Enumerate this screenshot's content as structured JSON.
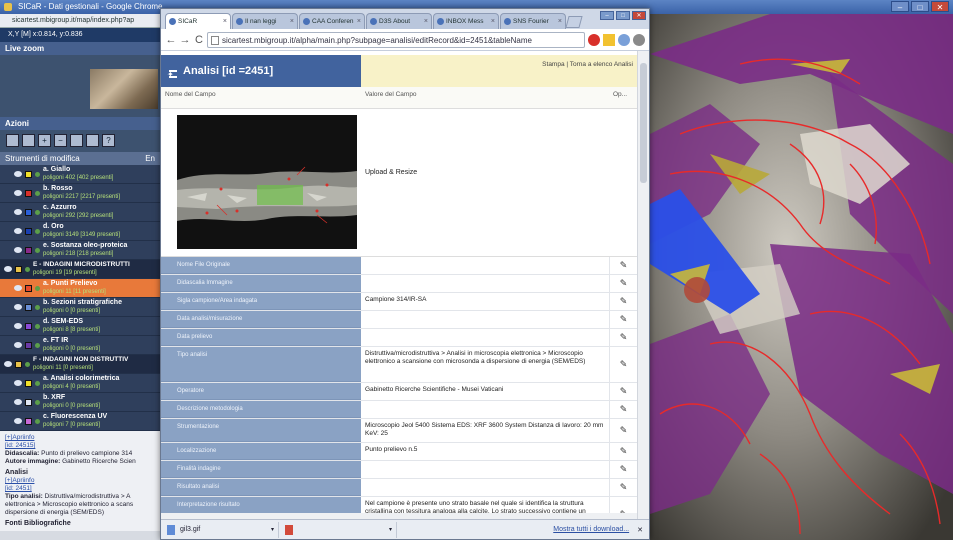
{
  "bg_window": {
    "title": "SICaR - Dati gestionali - Google Chrome",
    "address": "sicartest.mbigroup.it/map/index.php?ap",
    "coord_readout": "X,Y     [M] x:0.814, y:0.836"
  },
  "left_panel": {
    "live_zoom_title": "Live zoom",
    "actions_title": "Azioni",
    "tools_title": "Strumenti di modifica",
    "tools_right": "En",
    "layers": [
      {
        "name": "a. Giallo",
        "sub": "poligoni 402 [402 presenti]",
        "color": "#f0e02a",
        "type": "sub"
      },
      {
        "name": "b. Rosso",
        "sub": "poligoni 2217 [2217 presenti]",
        "color": "#d8302a",
        "type": "sub"
      },
      {
        "name": "c. Azzurro",
        "sub": "poligoni 292 [292 presenti]",
        "color": "#2a5fd8",
        "type": "sub"
      },
      {
        "name": "d. Oro",
        "sub": "poligoni 3149 [3149 presenti]",
        "color": "#1a3fb0",
        "type": "sub"
      },
      {
        "name": "e. Sostanza oleo-proteica",
        "sub": "poligoni 218 [218 presenti]",
        "color": "#8a2a8a",
        "type": "sub"
      },
      {
        "name": "E - INDAGINI MICRODISTRUTTI",
        "sub": "poligoni 19 [19 presenti]",
        "color": "#e8c24a",
        "type": "group"
      },
      {
        "name": "a. Punti Prelievo",
        "sub": "poligoni 11 [11 presenti]",
        "color": "#e84a2a",
        "type": "selected"
      },
      {
        "name": "b. Sezioni stratigrafiche",
        "sub": "poligoni 0 [0 presenti]",
        "color": "#6a8fd6",
        "type": "sub"
      },
      {
        "name": "d. SEM-EDS",
        "sub": "poligoni 8 [8 presenti]",
        "color": "#8a4ad6",
        "type": "sub"
      },
      {
        "name": "e. FT IR",
        "sub": "poligoni 0 [0 presenti]",
        "color": "#6a3aa6",
        "type": "sub"
      },
      {
        "name": "F - INDAGINI NON DISTRUTTIV",
        "sub": "poligoni 11 [0 presenti]",
        "color": "#e8c24a",
        "type": "group"
      },
      {
        "name": "a. Analisi colorimetrica",
        "sub": "poligoni 4 [0 presenti]",
        "color": "#f0e02a",
        "type": "sub"
      },
      {
        "name": "b. XRF",
        "sub": "poligoni 0 [0 presenti]",
        "color": "#dfe6f3",
        "type": "sub"
      },
      {
        "name": "c. Fluorescenza UV",
        "sub": "poligoni 7 [0 presenti]",
        "color": "#c86ad6",
        "type": "sub"
      }
    ],
    "info": {
      "link1": "[+]Apriinfo",
      "id1": "[id: 24515]",
      "den_label": "Didascalia:",
      "den_value": "Punto di prelievo campione 314",
      "autore_label": "Autore immagine:",
      "autore_value": "Gabinetto Ricerche Scien",
      "analisi_title": "Analisi",
      "link2": "[+]Apriinfo",
      "id2": "[id: 2451]",
      "tipo_label": "Tipo analisi:",
      "tipo_value": "Distruttiva/microdistruttiva > A elettronica > Microscopio elettronico a scans dispersione di energia (SEM/EDS)",
      "fonti_title": "Fonti Bibliografiche"
    }
  },
  "browser": {
    "tabs": [
      {
        "label": "SICaR",
        "active": true
      },
      {
        "label": "Il nan leggi",
        "active": false
      },
      {
        "label": "CAA Conferen",
        "active": false
      },
      {
        "label": "D3S About",
        "active": false
      },
      {
        "label": "INBOX Mess",
        "active": false
      },
      {
        "label": "SNS Fourier",
        "active": false
      }
    ],
    "url": "sicartest.mbigroup.it/alpha/main.php?subpage=analisi/editRecord&id=2451&tableName",
    "page": {
      "title": "Analisi [id =2451]",
      "top_links": "Stampa | Torna a elenco Analisi",
      "col_name": "Nome del Campo",
      "col_value": "Valore del Campo",
      "col_ops": "Op...",
      "upload_label": "Upload & Resize",
      "rows": [
        {
          "key": "Nome File Originale",
          "value": ""
        },
        {
          "key": "Didascalia Immagine",
          "value": ""
        },
        {
          "key": "Sigla campione/Area indagata",
          "value": "Campione 314/IR-SA"
        },
        {
          "key": "Data analisi/misurazione",
          "value": ""
        },
        {
          "key": "Data prelievo",
          "value": ""
        },
        {
          "key": "Tipo analisi",
          "value": "Distruttiva/microdistruttiva > Analisi in microscopia elettronica > Microscopio elettronico a scansione con microsonda a dispersione di energia (SEM/EDS)"
        },
        {
          "key": "Operatore",
          "value": "Gabinetto Ricerche Scientifiche - Musei Vaticani"
        },
        {
          "key": "Descrizione metodologia",
          "value": ""
        },
        {
          "key": "Strumentazione",
          "value": "Microscopio Jeol 5400 Sistema EDS: XRF 3600 System Distanza di lavoro: 20 mm KeV: 25"
        },
        {
          "key": "Localizzazione",
          "value": "Punto prelievo n.5"
        },
        {
          "key": "Finalità indagine",
          "value": ""
        },
        {
          "key": "Risultato analisi",
          "value": ""
        },
        {
          "key": "Interpretazione risultato",
          "value": "Nel campione è presente uno strato basale nel quale si identifica la struttura cristallina con tessitura analoga alla calcite. Lo strato successivo contiene un pigmento che per composizione chimica e"
        }
      ]
    },
    "downloads": [
      {
        "name": "gil3.gif",
        "kind": "image"
      },
      {
        "name": "",
        "kind": "pdf"
      }
    ],
    "show_all_downloads": "Mostra tutti i download..."
  },
  "colors": {
    "title_bar": "#41639e",
    "key_cell": "#8aa2c4",
    "selected_layer": "#e8793a",
    "link": "#2b4fa3"
  }
}
